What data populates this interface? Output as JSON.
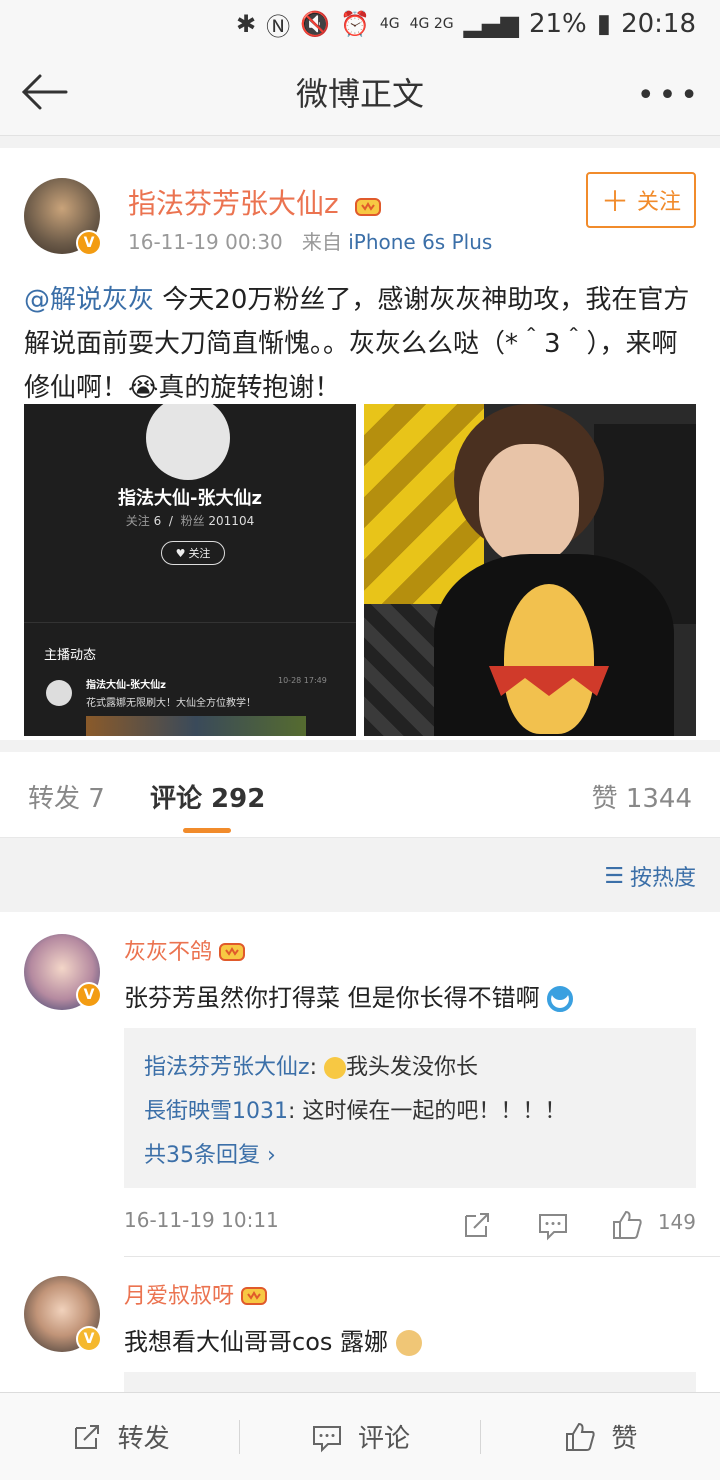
{
  "status": {
    "time": "20:18",
    "battery": "21%",
    "net1": "4G",
    "net2": "4G 2G"
  },
  "nav": {
    "title": "微博正文"
  },
  "post": {
    "author": "指法芬芳张大仙z",
    "time": "16-11-19 00:30",
    "from_label": "来自",
    "source": "iPhone 6s Plus",
    "follow": "关注",
    "mention": "@解说灰灰",
    "text": " 今天20万粉丝了，感谢灰灰神助攻，我在官方解说面前耍大刀简直惭愧。。灰灰么么哒（*＾3＾），来啊修仙啊！😭真的旋转抱谢！",
    "image1": {
      "name": "指法大仙-张大仙z",
      "follow_count_label": "关注",
      "follow_count": "6",
      "fans_label": "粉丝",
      "fans": "201104",
      "follow_btn": "关注",
      "section": "主播动态",
      "entry_name": "指法大仙-张大仙z",
      "entry_time": "10-28 17:49",
      "entry_text": "花式露娜无限刷大！大仙全方位教学！"
    }
  },
  "tabs": {
    "repost": "转发 7",
    "comment": "评论 292",
    "like": "赞 1344"
  },
  "sort": {
    "label": "按热度"
  },
  "comments": [
    {
      "name": "灰灰不鸽",
      "text": "张芬芳虽然你打得菜 但是你长得不错啊",
      "replies": [
        {
          "name": "指法芬芳张大仙z",
          "text": "我头发没你长"
        },
        {
          "name": "長街映雪1031",
          "text": "这时候在一起的吧！！！！"
        }
      ],
      "more": "共35条回复 ›",
      "time": "16-11-19 10:11",
      "likes": "149"
    },
    {
      "name": "月爱叔叔呀",
      "text": "我想看大仙哥哥cos 露娜"
    }
  ],
  "bottom": {
    "repost": "转发",
    "comment": "评论",
    "like": "赞"
  },
  "colors": {
    "accent": "#f18b2b",
    "name": "#eb7350",
    "link": "#3b6fa8"
  }
}
